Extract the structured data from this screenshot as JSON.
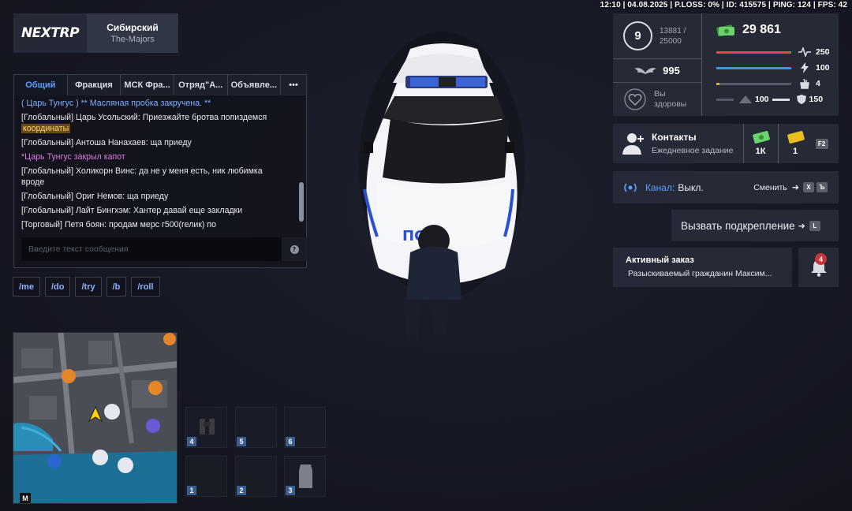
{
  "status_line": "12:10 | 04.08.2025 | P.LOSS: 0% | ID: 415575 | PING: 124 | FPS: 42",
  "server": {
    "logo_text": "NEXTRP",
    "name": "Сибирский",
    "sub": "The-Majors"
  },
  "chat": {
    "tabs": [
      {
        "label": "Общий",
        "active": true
      },
      {
        "label": "Фракция"
      },
      {
        "label": "МСК Фра..."
      },
      {
        "label": "Отряд\"А..."
      },
      {
        "label": "Объявле..."
      },
      {
        "label": "•••"
      }
    ],
    "messages": [
      {
        "text": "( Царь Тунгус ) ** Масляная пробка закручена. **",
        "style": "blue"
      },
      {
        "text": "[Глобальный] Царь Усольский: Приезжайте бротва попиздемся",
        "highlight": "координаты"
      },
      {
        "text": "[Глобальный] Антоша Нанахаев: ща приеду"
      },
      {
        "text": "*Царь Тунгус закрыл капот",
        "style": "pink"
      },
      {
        "text": "[Глобальный] Холикорн Винс: да не у меня есть, ник любимка вроде"
      },
      {
        "text": "[Глобальный] Ориг Немов: ща приеду"
      },
      {
        "text": "[Глобальный] Лайт Бингхэм: Хантер давай еще закладки"
      },
      {
        "text": "[Торговый] Петя боян: продам мерс г500(гелик) по"
      }
    ],
    "input_placeholder": "Введите текст сообщения",
    "help_label": "?"
  },
  "commands": [
    "/me",
    "/do",
    "/try",
    "/b",
    "/roll"
  ],
  "minimap": {
    "key": "M"
  },
  "inventory": {
    "slots": [
      {
        "num": "4",
        "icon": "binoculars-icon"
      },
      {
        "num": "5",
        "icon": ""
      },
      {
        "num": "6",
        "icon": ""
      },
      {
        "num": "1",
        "icon": ""
      },
      {
        "num": "2",
        "icon": ""
      },
      {
        "num": "3",
        "icon": "vest-icon"
      }
    ]
  },
  "stats": {
    "level": "9",
    "xp_current": "13881 /",
    "xp_total": "25000",
    "reputation": "995",
    "health_line1": "Вы",
    "health_line2": "здоровы",
    "money": "29 861",
    "bars": [
      {
        "icon": "heartbeat-icon",
        "value": "250",
        "fill": 1.0,
        "color": "#e5484d"
      },
      {
        "icon": "energy-icon",
        "value": "100",
        "fill": 1.0,
        "color": "#2f9be0"
      },
      {
        "icon": "food-icon",
        "value": "4",
        "fill": 0.04,
        "color": "#e6a72a"
      }
    ],
    "extra_left_value": "100",
    "extra_right_value": "150"
  },
  "contacts": {
    "title": "Контакты",
    "sub": "Ежедневное задание",
    "reward_money": "1К",
    "reward_ticket": "1",
    "key": "F2"
  },
  "channel": {
    "label": "Канал:",
    "value": "Выкл.",
    "switch_label": "Сменить",
    "keys": [
      "X",
      "Ъ"
    ]
  },
  "backup": {
    "label": "Вызвать подкрепление",
    "key": "L"
  },
  "order": {
    "title": "Активный заказ",
    "sub": "Разыскиваемый гражданин Максим...",
    "badge": "4"
  },
  "colors": {
    "accent": "#5aa0ff",
    "panel": "#282c3a",
    "money": "#5cc15c"
  }
}
